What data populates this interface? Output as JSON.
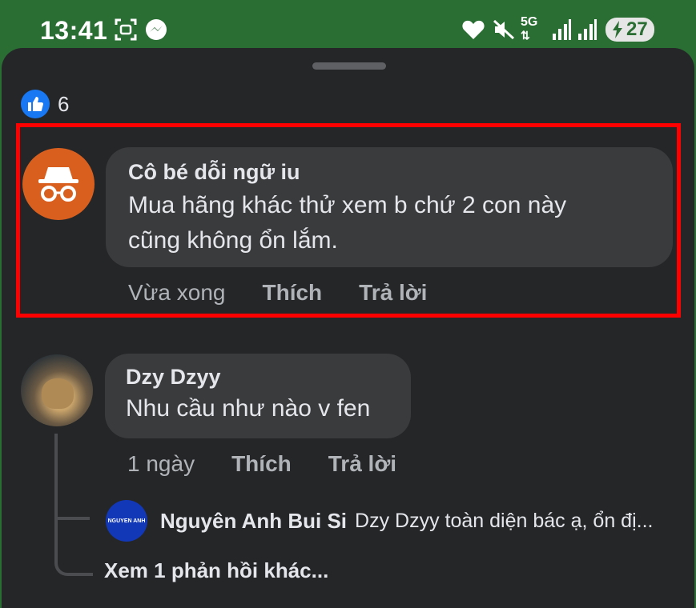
{
  "status_bar": {
    "time": "13:41",
    "network": "5G",
    "battery": "27",
    "icons": [
      "screenshot-icon",
      "messenger-icon",
      "heart-icon",
      "mute-icon",
      "signal-icon",
      "signal-icon",
      "battery-charging-icon"
    ]
  },
  "reactions": {
    "like_count": "6",
    "icon": "like-icon"
  },
  "comments": [
    {
      "author": "Cô bé dỗi ngữ iu",
      "text": "Mua hãng khác thử xem b chứ 2 con này cũng không ổn lắm.",
      "time": "Vừa xong",
      "like_label": "Thích",
      "reply_label": "Trả lời",
      "avatar_icon": "incognito-icon",
      "highlighted": true
    },
    {
      "author": "Dzy Dzyy",
      "text": "Nhu cầu như nào v fen",
      "time": "1 ngày",
      "like_label": "Thích",
      "reply_label": "Trả lời",
      "reply_preview": {
        "avatar_text": "NGUYEN ANH",
        "author": "Nguyên Anh Bui Si",
        "text": "Dzy Dzyy toàn diện bác ạ, ổn đị..."
      },
      "more_replies": "Xem 1 phản hồi khác..."
    }
  ],
  "colors": {
    "status_bar_bg": "#2b6e34",
    "sheet_bg": "#252628",
    "bubble_bg": "#3a3b3c",
    "highlight_border": "#ff0000",
    "like_blue": "#1877f2",
    "incognito_avatar": "#d95f1f"
  }
}
